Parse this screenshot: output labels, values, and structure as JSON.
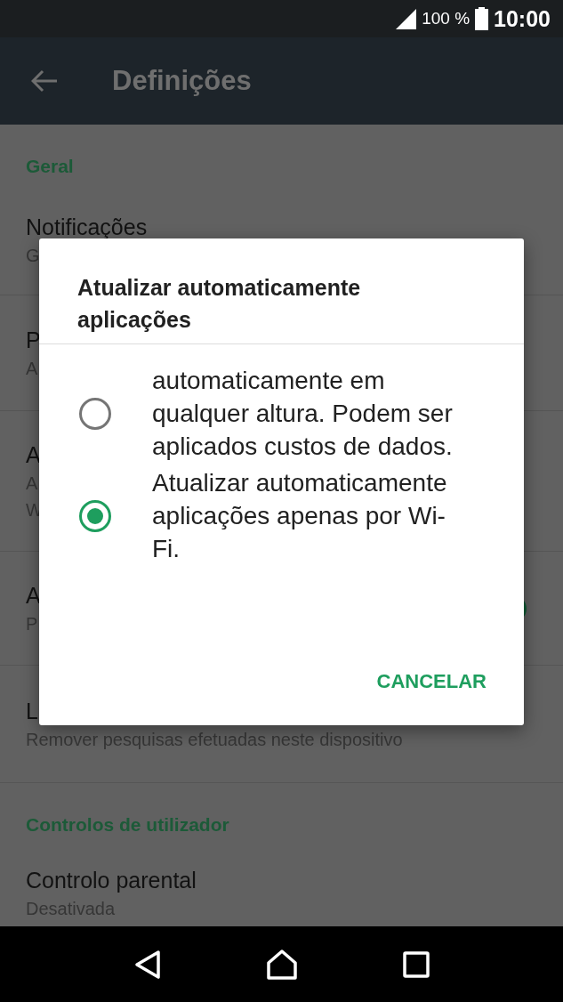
{
  "status_bar": {
    "battery": "100 %",
    "time": "10:00"
  },
  "app_bar": {
    "title": "Definições"
  },
  "sections": [
    {
      "header": "Geral",
      "items": [
        {
          "title": "Notificações",
          "subtitle_lines": [
            "G"
          ]
        },
        {
          "title": "P",
          "subtitle_lines": [
            "A"
          ]
        },
        {
          "title": "A",
          "subtitle_lines": [
            "A",
            "W"
          ]
        },
        {
          "title": "A",
          "subtitle_lines": [
            "P"
          ],
          "switch": {
            "on": true
          }
        },
        {
          "title": "L",
          "subtitle_lines": [
            "Remover pesquisas efetuadas neste dispositivo"
          ]
        }
      ]
    },
    {
      "header": "Controlos de utilizador",
      "items": [
        {
          "title": "Controlo parental",
          "subtitle_lines": [
            "Desativada"
          ]
        }
      ]
    }
  ],
  "dialog": {
    "title": "Atualizar automaticamente aplicações",
    "options": [
      {
        "label": "automaticamente em qualquer altura. Podem ser aplicados custos de dados.",
        "selected": false
      },
      {
        "label": "Atualizar automaticamente aplicações apenas por Wi-Fi.",
        "selected": true
      }
    ],
    "button": "CANCELAR"
  }
}
